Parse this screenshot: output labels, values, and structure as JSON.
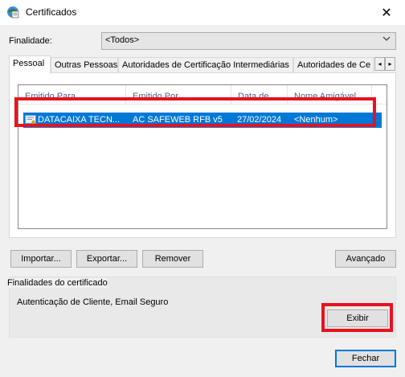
{
  "window": {
    "title": "Certificados",
    "close_glyph": "✕",
    "app_icon": "certificate-app-icon"
  },
  "purpose": {
    "label": "Finalidade:",
    "label_underline_char": "F",
    "selected": "<Todos>"
  },
  "tabs": [
    {
      "label": "Pessoal",
      "active": true
    },
    {
      "label": "Outras Pessoas",
      "active": false
    },
    {
      "label": "Autoridades de Certificação Intermediárias",
      "active": false
    },
    {
      "label": "Autoridades de Ce",
      "active": false
    }
  ],
  "tab_scroll": {
    "left": "◂",
    "right": "▸"
  },
  "list": {
    "columns": [
      "Emitido Para",
      "Emitido Por",
      "Data de ...",
      "Nome Amigável"
    ],
    "rows": [
      {
        "issued_to": "DATACAIXA TECN...",
        "issued_by": "AC SAFEWEB RFB v5",
        "expiry": "27/02/2024",
        "friendly_name": "<Nenhum>",
        "selected": true
      }
    ]
  },
  "buttons": {
    "import": "Importar...",
    "export": "Exportar...",
    "remove": "Remover",
    "advanced": "Avançado",
    "view": "Exibir",
    "close": "Fechar"
  },
  "purposes_group": {
    "title": "Finalidades do certificado",
    "value": "Autenticação de Cliente, Email Seguro"
  },
  "colors": {
    "selection": "#0078d7",
    "highlight_box": "#e8121e"
  }
}
